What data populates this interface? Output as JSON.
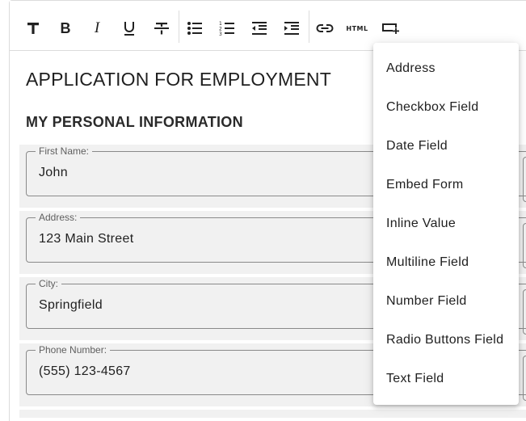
{
  "toolbar": {
    "buttons": [
      {
        "name": "text-style-icon"
      },
      {
        "name": "bold-icon"
      },
      {
        "name": "italic-icon"
      },
      {
        "name": "underline-icon"
      },
      {
        "name": "strikethrough-icon"
      },
      {
        "name": "bullet-list-icon"
      },
      {
        "name": "numbered-list-icon"
      },
      {
        "name": "outdent-icon"
      },
      {
        "name": "indent-icon"
      },
      {
        "name": "link-icon"
      },
      {
        "name": "html-icon",
        "label": "HTML"
      },
      {
        "name": "insert-field-icon"
      }
    ]
  },
  "document": {
    "title": "APPLICATION FOR EMPLOYMENT",
    "section_heading": "MY PERSONAL INFORMATION",
    "fields": [
      {
        "label": "First Name:",
        "value": "John"
      },
      {
        "label": "Address:",
        "value": "123 Main Street"
      },
      {
        "label": "City:",
        "value": "Springfield"
      },
      {
        "label": "Phone Number:",
        "value": "(555) 123-4567"
      }
    ]
  },
  "insert_menu": {
    "items": [
      "Address",
      "Checkbox Field",
      "Date Field",
      "Embed Form",
      "Inline Value",
      "Multiline Field",
      "Number Field",
      "Radio Buttons Field",
      "Text Field"
    ]
  }
}
